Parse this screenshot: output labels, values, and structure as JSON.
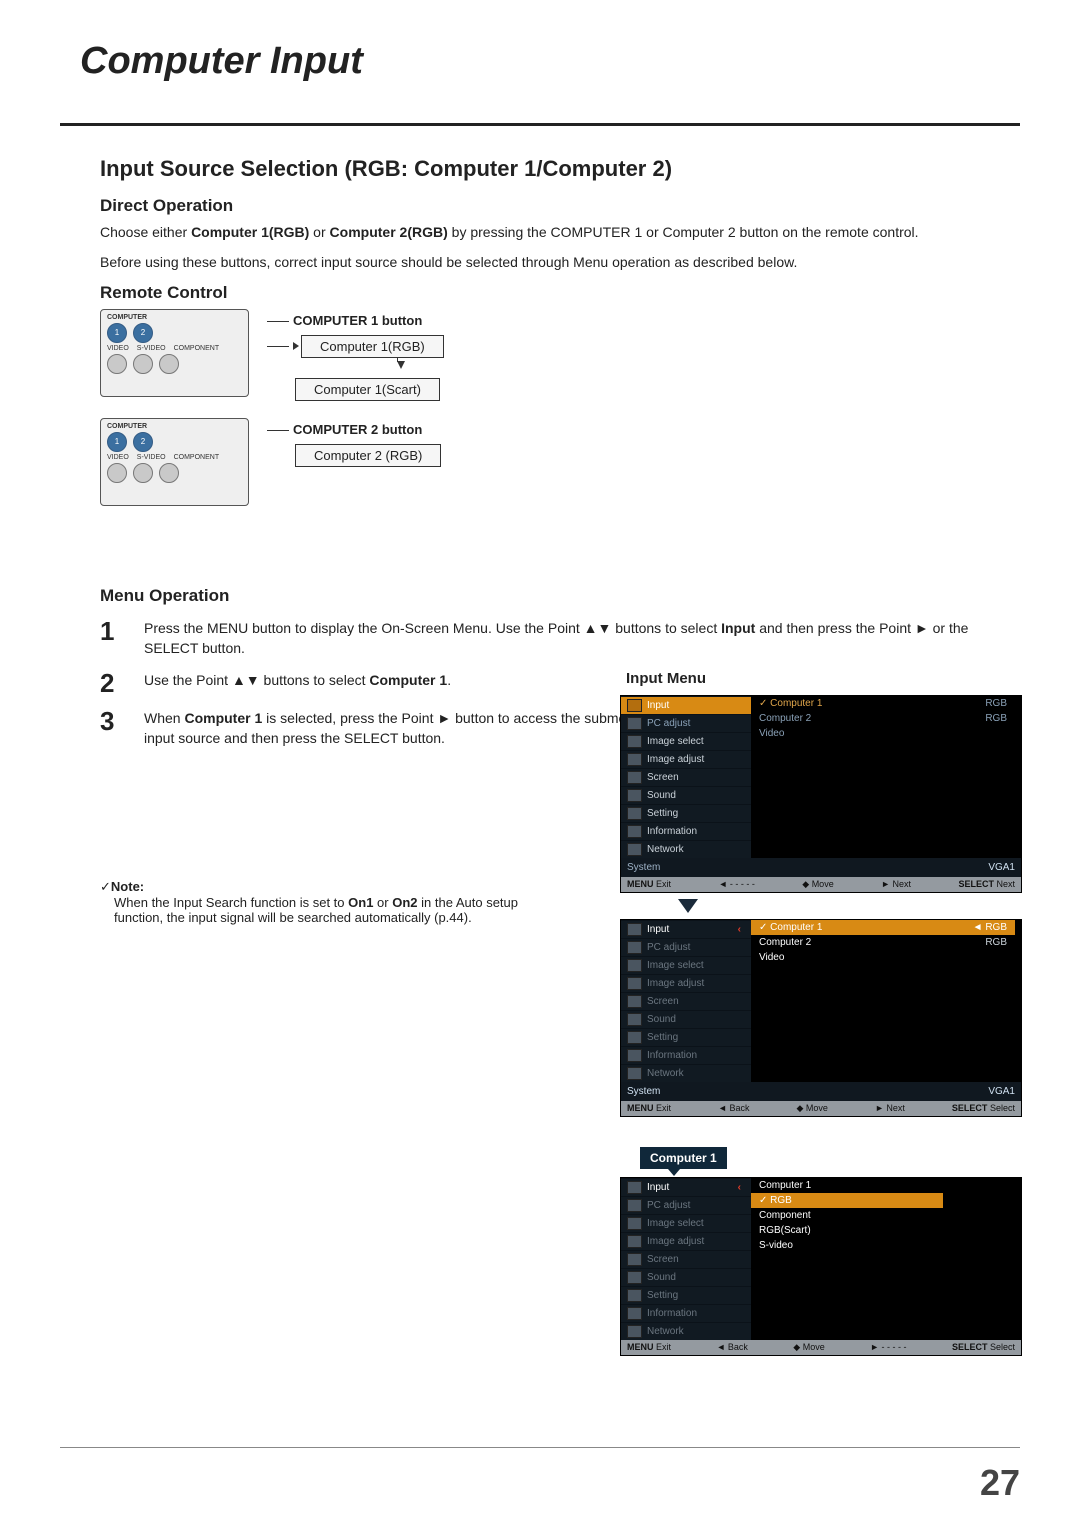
{
  "header": {
    "title": "Computer Input"
  },
  "section": {
    "title": "Input Source Selection (RGB: Computer 1/Computer 2)",
    "direct_operation": {
      "heading": "Direct Operation",
      "line1_pre": "Choose either ",
      "opt1": "Computer 1(RGB)",
      "mid": " or ",
      "opt2": "Computer 2(RGB)",
      "line1_post": " by pressing the COMPUTER 1 or Computer 2 button on the remote control.",
      "line2": "Before using these buttons, correct input source should be selected through Menu operation as described below."
    },
    "remote": {
      "heading": "Remote Control",
      "labels": {
        "computer": "COMPUTER",
        "one": "1",
        "two": "2",
        "video": "VIDEO",
        "svideo": "S-VIDEO",
        "component": "COMPONENT"
      },
      "c1": {
        "button_title": "COMPUTER 1 button",
        "opt_rgb": "Computer 1(RGB)",
        "opt_scart": "Computer 1(Scart)"
      },
      "c2": {
        "button_title": "COMPUTER 2 button",
        "opt_rgb": "Computer 2 (RGB)"
      }
    },
    "menu_op": {
      "heading": "Menu Operation",
      "s1_pre": "Press the MENU button to display the On-Screen Menu. Use the Point ▲▼ buttons to select ",
      "s1_bold": "Input",
      "s1_post": " and then press the Point ► or the SELECT button.",
      "s2_pre": "Use the Point ▲▼ buttons to select ",
      "s2_bold": "Computer 1",
      "s2_post": ".",
      "s3_pre": "When ",
      "s3_bold": "Computer 1",
      "s3_post": " is selected, press the Point ► button to access the submenu items. Use the Point ▲▼ buttons to select the RGB input source and then press the SELECT button."
    },
    "note": {
      "label": "Note:",
      "pre": "When the Input Search function is set to ",
      "on1": "On1",
      "mid": " or ",
      "on2": "On2",
      "post": " in the Auto setup function, the input signal will be searched automatically (p.44)."
    }
  },
  "osd": {
    "title": "Input Menu",
    "menu_items": {
      "input": "Input",
      "pc_adjust": "PC adjust",
      "image_select": "Image select",
      "image_adjust": "Image adjust",
      "screen": "Screen",
      "sound": "Sound",
      "setting": "Setting",
      "information": "Information",
      "network": "Network"
    },
    "opts": {
      "computer1": "Computer 1",
      "computer2": "Computer 2",
      "video": "Video",
      "rgb": "RGB",
      "component": "Component",
      "rgb_scart": "RGB(Scart)",
      "svideo": "S-video"
    },
    "sys": {
      "label": "System",
      "value": "VGA1"
    },
    "foot": {
      "exit_key": "MENU",
      "exit": "Exit",
      "back": "Back",
      "dashes": "- - - - -",
      "move": "Move",
      "next": "Next",
      "select_key": "SELECT",
      "select": "Select"
    },
    "flag": "Computer 1"
  },
  "page_number": "27"
}
